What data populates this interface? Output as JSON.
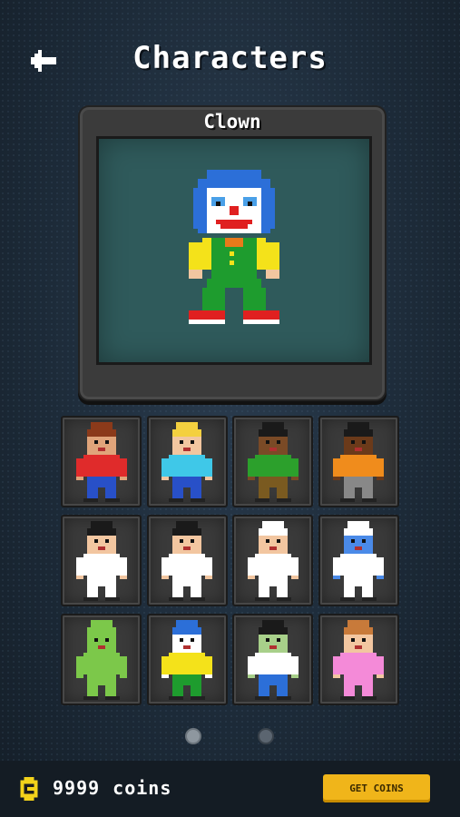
{
  "header": {
    "title": "Characters",
    "back_icon": "arrow-left-icon"
  },
  "preview": {
    "name": "Clown",
    "selected_character": "clown"
  },
  "characters": [
    {
      "id": "boy-red",
      "skin": "#e0a47a",
      "hair": "#8b3a1a",
      "shirt": "#e02b2b",
      "pants": "#2850c8"
    },
    {
      "id": "girl-blonde",
      "skin": "#f2c6a0",
      "hair": "#f4d03f",
      "shirt": "#3fc8e8",
      "pants": "#2850c8"
    },
    {
      "id": "boy-green",
      "skin": "#7a4a26",
      "hair": "#1a1a1a",
      "shirt": "#2ca02c",
      "pants": "#7a5a20"
    },
    {
      "id": "girl-orange",
      "skin": "#6b3a1a",
      "hair": "#1a1a1a",
      "shirt": "#f08c1c",
      "pants": "#888888"
    },
    {
      "id": "karate-boy",
      "skin": "#f2c6a0",
      "hair": "#1a1a1a",
      "shirt": "#ffffff",
      "pants": "#ffffff"
    },
    {
      "id": "karate-girl",
      "skin": "#f2c6a0",
      "hair": "#1a1a1a",
      "shirt": "#ffffff",
      "pants": "#ffffff"
    },
    {
      "id": "chef",
      "skin": "#f2c6a0",
      "hair": "#ffffff",
      "shirt": "#ffffff",
      "pants": "#ffffff"
    },
    {
      "id": "astronaut",
      "skin": "#4a8ae8",
      "hair": "#ffffff",
      "shirt": "#ffffff",
      "pants": "#ffffff"
    },
    {
      "id": "alien",
      "skin": "#7cc84a",
      "hair": "#7cc84a",
      "shirt": "#7cc84a",
      "pants": "#7cc84a"
    },
    {
      "id": "clown",
      "skin": "#ffffff",
      "hair": "#2c6fd8",
      "shirt": "#f4e21a",
      "pants": "#1e9c2e"
    },
    {
      "id": "zombie",
      "skin": "#a8d08a",
      "hair": "#1a1a1a",
      "shirt": "#ffffff",
      "pants": "#2c6fd8"
    },
    {
      "id": "ballerina",
      "skin": "#f2c6a0",
      "hair": "#c87a3a",
      "shirt": "#f48ad8",
      "pants": "#f48ad8"
    }
  ],
  "pager": {
    "pages": 2,
    "current": 1
  },
  "footer": {
    "coin_icon": "coin-icon",
    "coins_value": "9999",
    "coins_label": "coins",
    "get_coins_label": "GET COINS"
  }
}
